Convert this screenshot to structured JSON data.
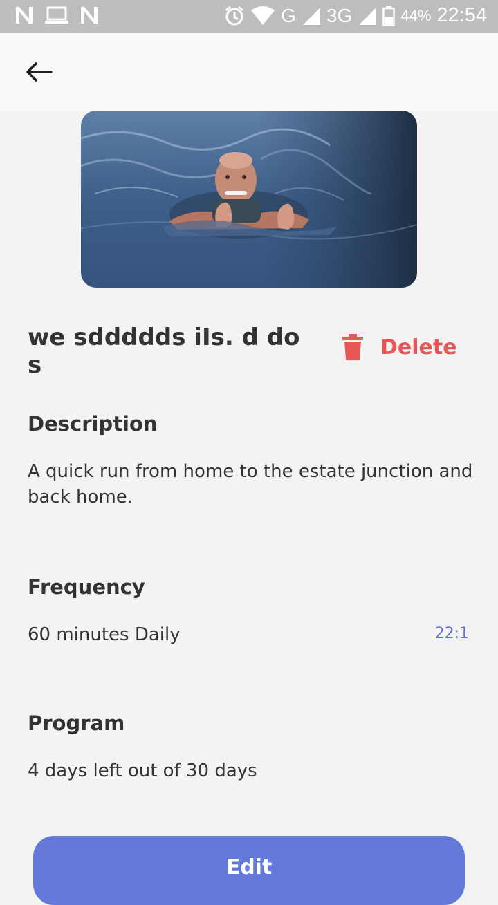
{
  "status_bar": {
    "network": "G",
    "network2": "3G",
    "battery_percent": "44%",
    "time": "22:54"
  },
  "toolbar": {
    "back_icon": "arrow-left-icon"
  },
  "activity": {
    "title": "we sddddds iIs. d do s",
    "delete_label": "Delete",
    "description_heading": "Description",
    "description": "A quick run from home to the estate junction and back home.",
    "frequency_heading": "Frequency",
    "frequency": "60 minutes Daily",
    "frequency_time": "22:1",
    "program_heading": "Program",
    "program": "4 days left out of 30 days",
    "edit_label": "Edit"
  },
  "colors": {
    "accent": "#6279da",
    "danger": "#e85656",
    "link": "#6272d8"
  }
}
